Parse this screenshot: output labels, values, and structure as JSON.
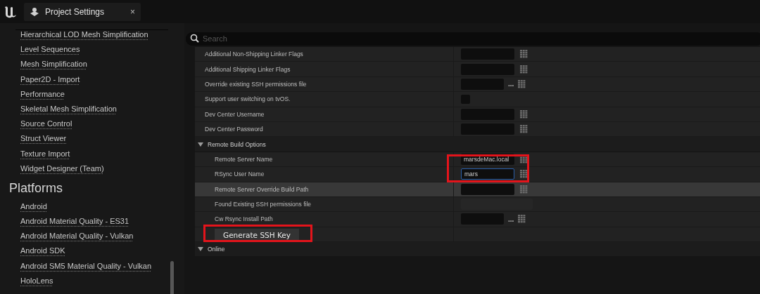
{
  "tab": {
    "title": "Project Settings",
    "close": "×"
  },
  "sidebar": {
    "items": [
      {
        "label": "Hierarchical LOD Mesh Simplification"
      },
      {
        "label": "Level Sequences"
      },
      {
        "label": "Mesh Simplification"
      },
      {
        "label": "Paper2D - Import"
      },
      {
        "label": "Performance"
      },
      {
        "label": "Skeletal Mesh Simplification"
      },
      {
        "label": "Source Control"
      },
      {
        "label": "Struct Viewer"
      },
      {
        "label": "Texture Import"
      },
      {
        "label": "Widget Designer (Team)"
      }
    ],
    "section": {
      "title": "Platforms",
      "items": [
        {
          "label": "Android"
        },
        {
          "label": "Android Material Quality - ES31"
        },
        {
          "label": "Android Material Quality - Vulkan"
        },
        {
          "label": "Android SDK"
        },
        {
          "label": "Android SM5 Material Quality - Vulkan"
        },
        {
          "label": "HoloLens"
        }
      ]
    }
  },
  "search": {
    "placeholder": "Search"
  },
  "rows": [
    {
      "kind": "text",
      "label": "Additional Non-Shipping Linker Flags",
      "focused": false
    },
    {
      "kind": "text",
      "label": "Additional Shipping Linker Flags",
      "focused": false
    },
    {
      "kind": "path",
      "label": "Override existing SSH permissions file",
      "browse": "..."
    },
    {
      "kind": "checkbox",
      "label": "Support user switching on tvOS.",
      "checked": false
    },
    {
      "kind": "text",
      "label": "Dev Center Username",
      "focused": false
    },
    {
      "kind": "text",
      "label": "Dev Center Password",
      "focused": false
    }
  ],
  "categories": [
    {
      "title": "Remote Build Options",
      "expanded": true,
      "rows": [
        {
          "kind": "text",
          "label": "Remote Server Name",
          "value": "marsdeMac.local",
          "focused": false,
          "annotated": true
        },
        {
          "kind": "text",
          "label": "RSync User Name",
          "value": "mars",
          "focused": true,
          "annotated": true
        },
        {
          "kind": "text",
          "label": "Remote Server Override Build Path",
          "focused": false,
          "hovered": true
        },
        {
          "kind": "readonly",
          "label": "Found Existing SSH permissions file"
        },
        {
          "kind": "path",
          "label": "Cw Rsync Install Path",
          "browse": "..."
        },
        {
          "kind": "button",
          "label": "Generate SSH Key",
          "annotated": true
        }
      ]
    },
    {
      "title": "Online",
      "expanded": true
    }
  ]
}
